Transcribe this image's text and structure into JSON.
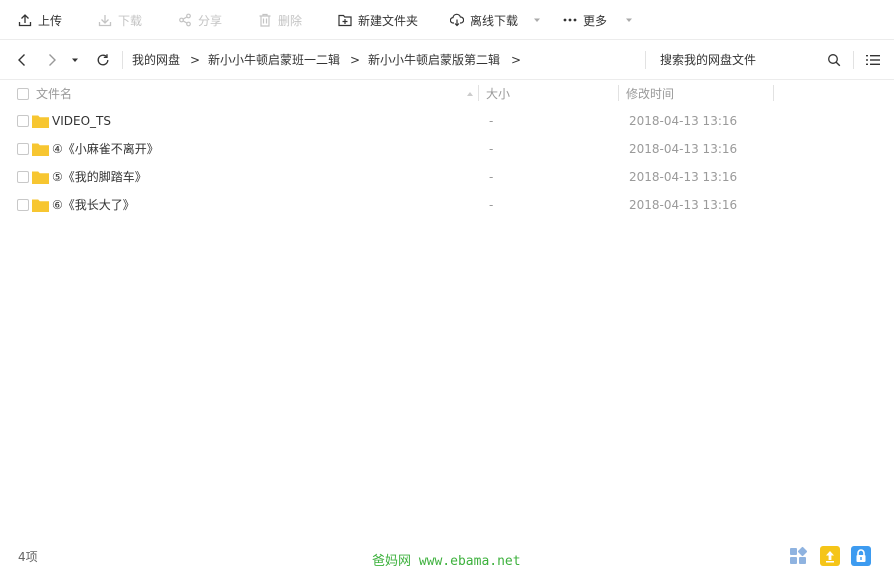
{
  "toolbar": {
    "upload": "上传",
    "download": "下载",
    "share": "分享",
    "delete": "删除",
    "new_folder": "新建文件夹",
    "offline_download": "离线下载",
    "more": "更多"
  },
  "navigation": {
    "breadcrumb": [
      "我的网盘",
      "新小小牛顿启蒙班一二辑",
      "新小小牛顿启蒙版第二辑"
    ],
    "separator": ">",
    "search_placeholder": "搜索我的网盘文件"
  },
  "columns": {
    "name": "文件名",
    "size": "大小",
    "modified": "修改时间"
  },
  "files": [
    {
      "name": "VIDEO_TS",
      "size": "-",
      "modified": "2018-04-13 13:16"
    },
    {
      "name": "④《小麻雀不离开》",
      "size": "-",
      "modified": "2018-04-13 13:16"
    },
    {
      "name": "⑤《我的脚踏车》",
      "size": "-",
      "modified": "2018-04-13 13:16"
    },
    {
      "name": "⑥《我长大了》",
      "size": "-",
      "modified": "2018-04-13 13:16"
    }
  ],
  "footer": {
    "item_count": "4项",
    "watermark": "爸妈网 www.ebama.net"
  },
  "colors": {
    "folder": "#f7c631",
    "watermark": "#3db13d",
    "footer_icon_yellow": "#f5c518",
    "footer_icon_blue": "#3d9bf0",
    "footer_icon_grid": "#8fb3e0"
  },
  "icons": [
    "upload-icon",
    "download-icon",
    "share-icon",
    "delete-icon",
    "new-folder-icon",
    "cloud-download-icon",
    "more-icon",
    "back-icon",
    "forward-icon",
    "history-dropdown-icon",
    "refresh-icon",
    "search-icon",
    "list-view-icon",
    "folder-icon",
    "grid-view-icon",
    "upload-file-icon",
    "lock-icon"
  ]
}
